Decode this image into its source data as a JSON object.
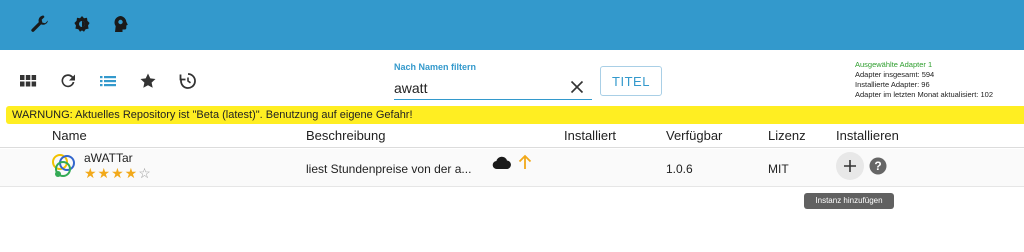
{
  "topbar": {
    "icons": [
      "wrench-icon",
      "settings-gear-icon",
      "user-head-icon"
    ]
  },
  "toolbar": {
    "icons": [
      "grid-view-icon",
      "refresh-icon",
      "list-view-icon",
      "star-icon",
      "update-history-icon"
    ]
  },
  "filter": {
    "label": "Nach Namen filtern",
    "value": "awatt",
    "title_button": "TITEL"
  },
  "stats": {
    "selected": "Ausgewählte Adapter 1",
    "total": "Adapter insgesamt: 594",
    "installed": "Installierte Adapter: 96",
    "updated": "Adapter im letzten Monat aktualisiert: 102"
  },
  "warning": "WARNUNG: Aktuelles Repository ist \"Beta (latest)\". Benutzung auf eigene Gefahr!",
  "table": {
    "headers": {
      "name": "Name",
      "description": "Beschreibung",
      "installed": "Installiert",
      "available": "Verfügbar",
      "license": "Lizenz",
      "install": "Installieren"
    },
    "rows": [
      {
        "name": "aWATTar",
        "stars_filled": "★★★★",
        "stars_empty": "☆",
        "rating": 4,
        "description": "liest Stundenpreise von der a...",
        "installed": "",
        "available": "1.0.6",
        "license": "MIT"
      }
    ]
  },
  "tooltip": "Instanz hinzufügen",
  "colors": {
    "topbar": "#3399cc",
    "warning": "#ffee22",
    "star": "#f2a91a",
    "upgrade_arrow": "#f2a91a",
    "accent": "#3399cc"
  }
}
